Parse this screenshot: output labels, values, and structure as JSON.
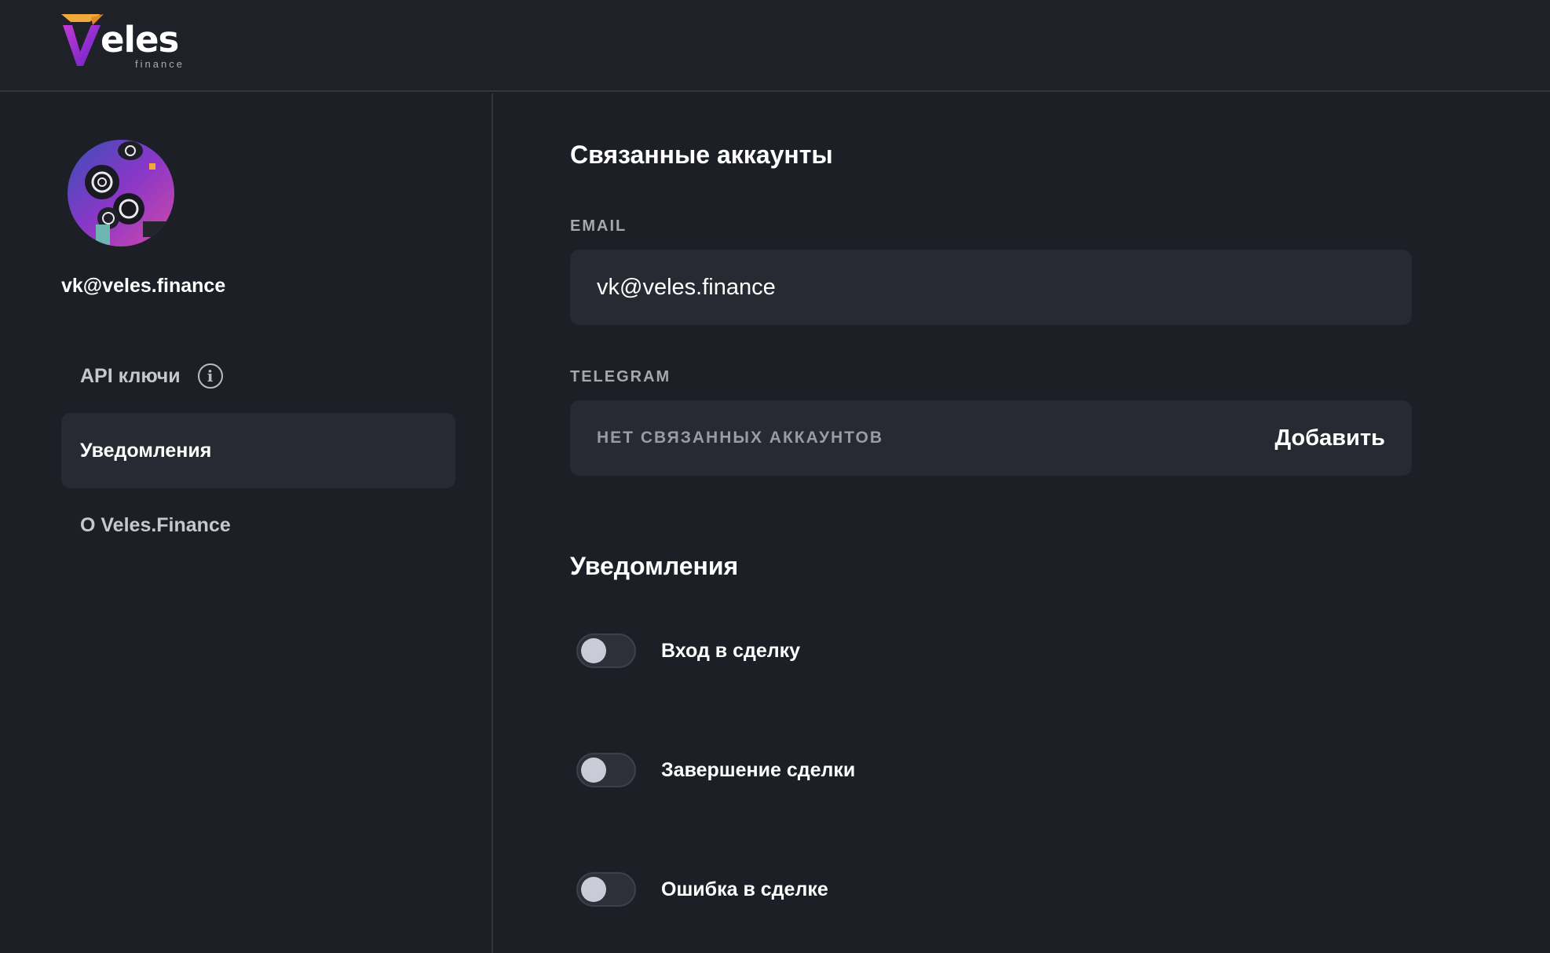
{
  "brand": {
    "name": "eles",
    "subtitle": "finance",
    "colors": {
      "gold": "#f2a93b",
      "purple": "#7b2fd0",
      "magenta": "#c23bd4"
    }
  },
  "sidebar": {
    "user_email": "vk@veles.finance",
    "items": [
      {
        "label": "API ключи",
        "icon": "info-icon",
        "active": false
      },
      {
        "label": "Уведомления",
        "active": true
      },
      {
        "label": "О Veles.Finance",
        "active": false
      }
    ]
  },
  "linked_accounts": {
    "title": "Связанные аккаунты",
    "email": {
      "label": "EMAIL",
      "value": "vk@veles.finance"
    },
    "telegram": {
      "label": "TELEGRAM",
      "status": "НЕТ СВЯЗАННЫХ АККАУНТОВ",
      "action": "Добавить"
    }
  },
  "notifications": {
    "title": "Уведомления",
    "toggles": [
      {
        "label": "Вход в сделку",
        "on": false
      },
      {
        "label": "Завершение сделки",
        "on": false
      },
      {
        "label": "Ошибка в сделке",
        "on": false
      }
    ]
  }
}
